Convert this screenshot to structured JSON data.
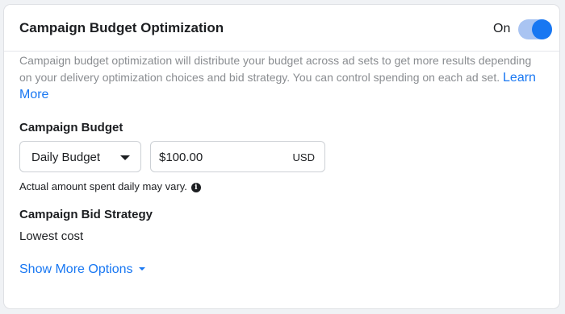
{
  "panel": {
    "title": "Campaign Budget Optimization",
    "toggle_label": "On",
    "toggle_state": "on",
    "description": "Campaign budget optimization will distribute your budget across ad sets to get more results depending on your delivery optimization choices and bid strategy. You can control spending on each ad set. ",
    "learn_more": "Learn More"
  },
  "budget": {
    "label": "Campaign Budget",
    "type_selected": "Daily Budget",
    "amount": "$100.00",
    "currency": "USD",
    "hint": "Actual amount spent daily may vary."
  },
  "bid_strategy": {
    "label": "Campaign Bid Strategy",
    "value": "Lowest cost"
  },
  "show_more": "Show More Options",
  "colors": {
    "accent": "#1877f2",
    "toggle_track": "#a9c4f2",
    "muted_text": "#8a8d91",
    "border": "#ccd0d5"
  }
}
